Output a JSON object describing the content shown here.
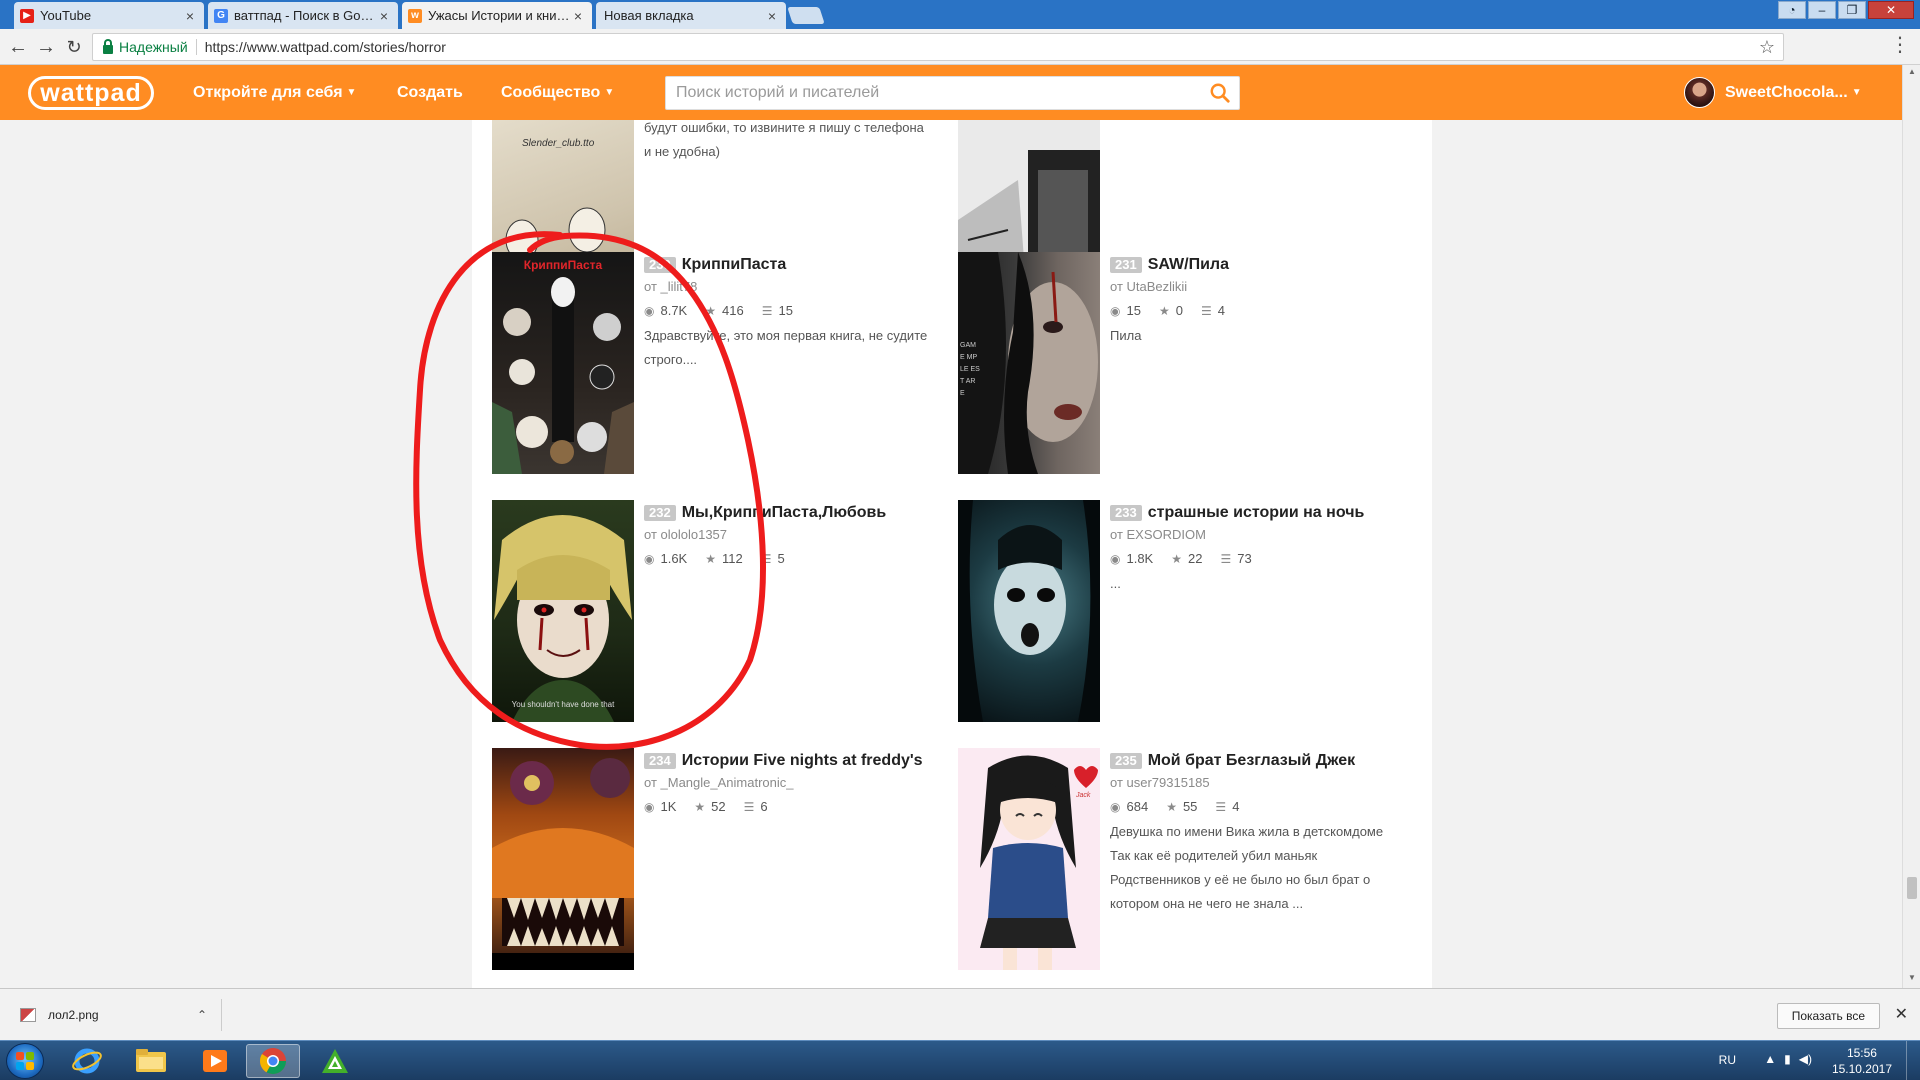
{
  "browser": {
    "tabs": [
      {
        "title": "YouTube",
        "favicon": "youtube-icon",
        "active": false
      },
      {
        "title": "ваттпад - Поиск в Google",
        "favicon": "google-icon",
        "active": false
      },
      {
        "title": "Ужасы Истории и книги бесплатно",
        "favicon": "wattpad-icon",
        "active": true
      },
      {
        "title": "Новая вкладка",
        "favicon": "",
        "active": false
      }
    ],
    "secure_label": "Надежный",
    "url": "https://www.wattpad.com/stories/horror"
  },
  "header": {
    "logo": "wattpad",
    "nav": {
      "discover": "Откройте для себя",
      "create": "Создать",
      "community": "Сообщество"
    },
    "search_placeholder": "Поиск историй и писателей",
    "username": "SweetChocola...",
    "brand_color": "#ff8c22"
  },
  "stories": {
    "prev_left_desc": "будут ошибки, то извините я пишу с телефона и не удобна)",
    "prev_left_cover_text": "Slender_club.tto",
    "cards": [
      {
        "rank": "230",
        "title": "КриппиПаста",
        "author": "от _lilit78",
        "reads": "8.7K",
        "votes": "416",
        "parts": "15",
        "desc": "Здравствуйте, это моя первая книга, не судите строго....",
        "cover_text": "КриппиПаста"
      },
      {
        "rank": "231",
        "title": "SAW/Пила",
        "author": "от UtaBezlikii",
        "reads": "15",
        "votes": "0",
        "parts": "4",
        "desc": "Пила",
        "cover_text": "GAME MPLE EST ARE"
      },
      {
        "rank": "232",
        "title": "Мы,КриппиПаста,Любовь",
        "author": "от olololo1357",
        "reads": "1.6K",
        "votes": "112",
        "parts": "5",
        "desc": "",
        "cover_text": "You shouldn't have done that"
      },
      {
        "rank": "233",
        "title": "страшные истории на ночь",
        "author": "от EXSORDIOM",
        "reads": "1.8K",
        "votes": "22",
        "parts": "73",
        "desc": "...",
        "cover_text": ""
      },
      {
        "rank": "234",
        "title": "Истории Five nights at freddy's",
        "author": "от _Mangle_Animatronic_",
        "reads": "1K",
        "votes": "52",
        "parts": "6",
        "desc": "",
        "cover_text": ""
      },
      {
        "rank": "235",
        "title": "Мой брат Безглазый Джек",
        "author": "от user79315185",
        "reads": "684",
        "votes": "55",
        "parts": "4",
        "desc": "Девушка по имени Вика жила в детскомдоме Так как её родителей убил маньяк Родственников у её не было но был брат о котором она не чего не знала ...",
        "cover_text": "Jack"
      }
    ]
  },
  "downloads": {
    "file": "лол2.png",
    "show_all": "Показать все"
  },
  "taskbar": {
    "lang": "RU",
    "time": "15:56",
    "date": "15.10.2017"
  }
}
